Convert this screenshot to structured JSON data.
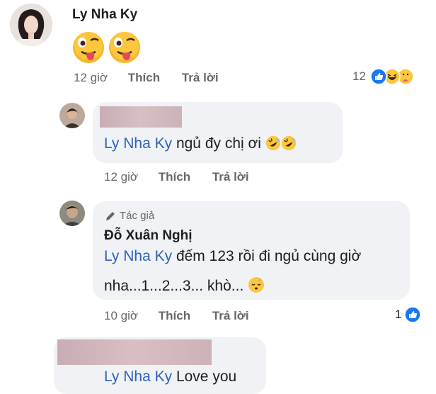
{
  "comments": [
    {
      "author": "Ly Nha Ky",
      "time": "12 giờ",
      "like": "Thích",
      "reply": "Trả lời",
      "reaction_count": "12"
    },
    {
      "mention": "Ly Nha Ky",
      "text": "ngủ đy chị ơi",
      "time": "12 giờ",
      "like": "Thích",
      "reply": "Trả lời"
    },
    {
      "badge": "Tác giả",
      "author": "Đỗ Xuân Nghị",
      "mention": "Ly Nha Ky",
      "text_line1": "đếm 123 rồi đi ngủ cùng giờ",
      "text_line2": "nha...1...2...3... khò...",
      "time": "10 giờ",
      "like": "Thích",
      "reply": "Trả lời",
      "reaction_count": "1"
    },
    {
      "mention": "Ly Nha Ky",
      "text": "Love you"
    }
  ],
  "colors": {
    "link_blue": "#2e62b5",
    "meta_gray": "#65676b",
    "bubble_bg": "#f0f2f5",
    "like_blue": "#1877f2"
  },
  "icons": [
    "avatar-photo",
    "tongue-emoji",
    "rofl-emoji",
    "sleepy-emoji",
    "like-icon",
    "haha-icon",
    "care-icon",
    "pen-icon"
  ]
}
